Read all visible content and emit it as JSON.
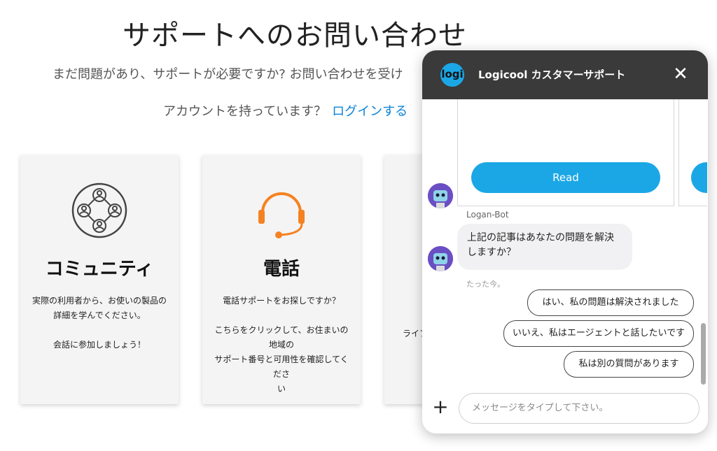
{
  "page": {
    "title": "サポートへのお問い合わせ",
    "subtitle": "まだ問題があり、サポートが必要ですか? お問い合わせを受け",
    "account_prompt": "アカウントを持っています？",
    "login_link": "ログインする"
  },
  "cards": [
    {
      "title": "コミュニティ",
      "text": "実際の利用者から、お使いの製品の\n詳細を学んでください。\n\n会話に参加しましょう！",
      "icon": "community-icon"
    },
    {
      "title": "電話",
      "text": "電話サポートをお探しですか？\n\nこちらをクリックして、お住まいの地域の\nサポート番号と可用性を確認してくださ\nい",
      "icon": "headset-icon"
    },
    {
      "partial_text": "ライフ"
    }
  ],
  "chat": {
    "logo_text": "logi",
    "title": "Logicool カスタマーサポート",
    "close_icon": "close-icon",
    "read_button": "Read",
    "bot_name": "Logan-Bot",
    "bot_message": "上記の記事はあなたの問題を解決しますか？",
    "timestamp": "たった今。",
    "quick_replies": [
      "はい、私の問題は解決されました",
      "いいえ、私はエージェントと話したいです",
      "私は別の質問があります"
    ],
    "input_placeholder": "メッセージをタイプして下さい。",
    "plus_icon": "plus-icon"
  },
  "colors": {
    "accent": "#1ba7e6",
    "header": "#3a3a3a",
    "link": "#0a84d6",
    "headset": "#f58220"
  }
}
